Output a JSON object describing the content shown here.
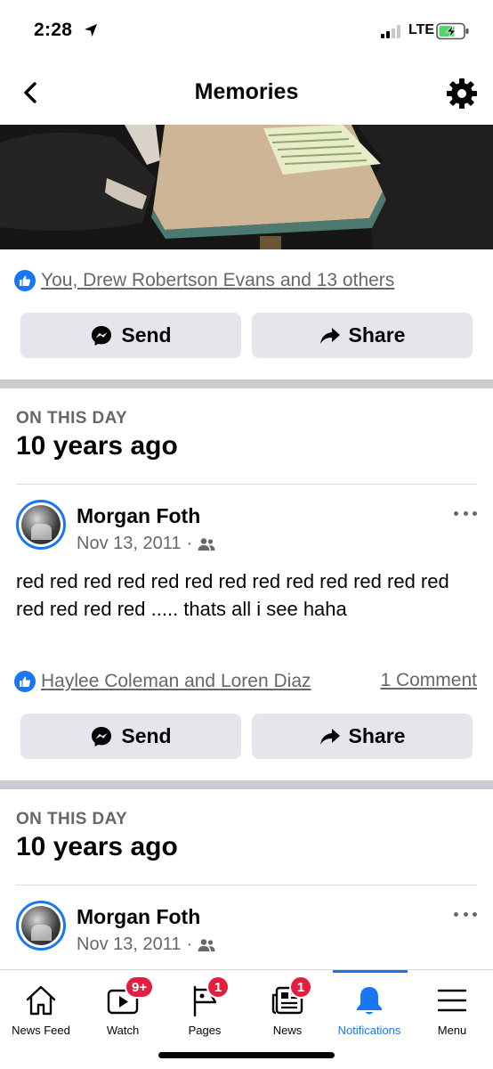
{
  "status_bar": {
    "time": "2:28",
    "network": "LTE"
  },
  "header": {
    "title": "Memories"
  },
  "first_post": {
    "reactions": "You, Drew Robertson Evans and 13 others",
    "send_label": "Send",
    "share_label": "Share"
  },
  "memories": [
    {
      "section_label": "ON THIS DAY",
      "years_ago": "10 years ago",
      "author": "Morgan Foth",
      "date": "Nov 13, 2011",
      "separator": "·",
      "text": "red red red red red red red red red red red red red red red red red ..... thats all i see haha",
      "reactions": "Haylee Coleman and Loren Diaz",
      "comments": "1 Comment",
      "send_label": "Send",
      "share_label": "Share"
    },
    {
      "section_label": "ON THIS DAY",
      "years_ago": "10 years ago",
      "author": "Morgan Foth",
      "date": "Nov 13, 2011",
      "separator": "·"
    }
  ],
  "tabbar": {
    "accent": "#1877f2",
    "tabs": [
      {
        "label": "News Feed",
        "icon": "home-icon"
      },
      {
        "label": "Watch",
        "icon": "watch-icon",
        "badge": "9+"
      },
      {
        "label": "Pages",
        "icon": "pages-flag-icon",
        "badge": "1"
      },
      {
        "label": "News",
        "icon": "news-icon",
        "badge": "1"
      },
      {
        "label": "Notifications",
        "icon": "bell-icon",
        "active": true
      },
      {
        "label": "Menu",
        "icon": "hamburger-menu-icon"
      }
    ]
  }
}
